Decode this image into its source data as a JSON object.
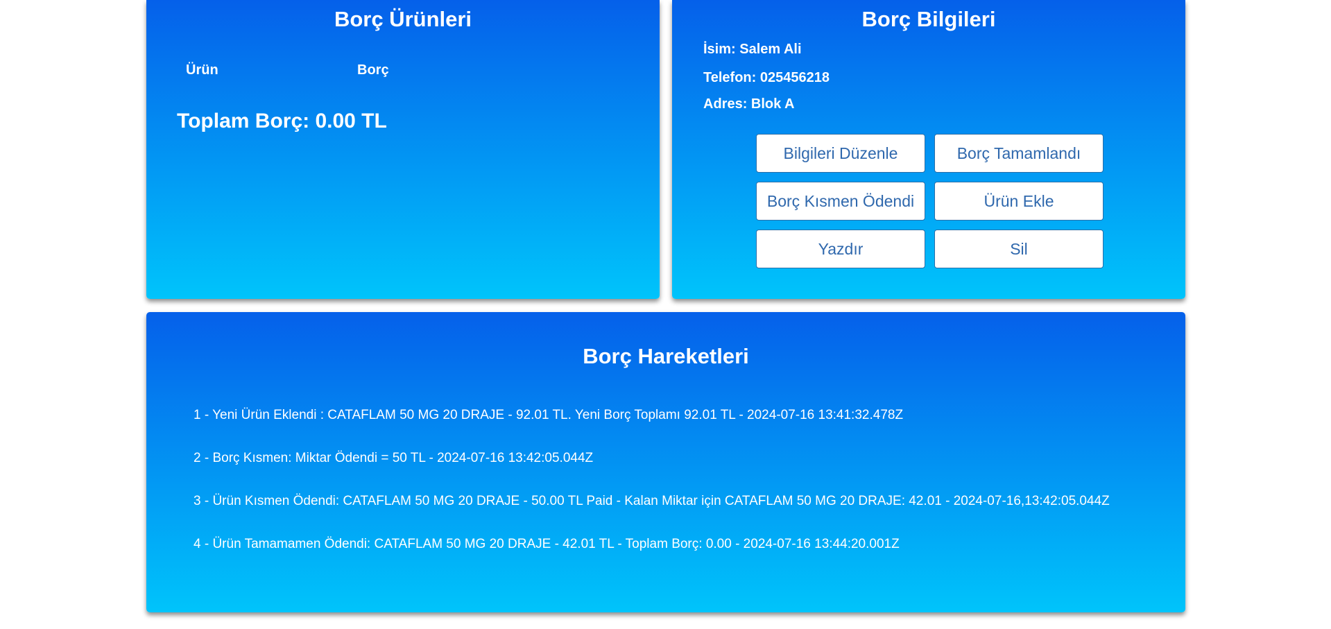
{
  "products_panel": {
    "title": "Borç Ürünleri",
    "col_product": "Ürün",
    "col_debt": "Borç",
    "total": "Toplam Borç: 0.00 TL"
  },
  "info_panel": {
    "title": "Borç Bilgileri",
    "name": "İsim: Salem Ali",
    "phone": "Telefon: 025456218",
    "address": "Adres: Blok A",
    "buttons": {
      "edit": "Bilgileri Düzenle",
      "completed": "Borç Tamamlandı",
      "partial": "Borç Kısmen Ödendi",
      "add_product": "Ürün Ekle",
      "print": "Yazdır",
      "delete": "Sil"
    }
  },
  "history_panel": {
    "title": "Borç Hareketleri",
    "items": [
      "1 - Yeni Ürün Eklendi : CATAFLAM 50 MG 20 DRAJE - 92.01 TL. Yeni Borç Toplamı 92.01 TL - 2024-07-16 13:41:32.478Z",
      "2 - Borç Kısmen: Miktar Ödendi = 50 TL - 2024-07-16 13:42:05.044Z",
      "3 - Ürün Kısmen Ödendi: CATAFLAM 50 MG 20 DRAJE - 50.00 TL Paid - Kalan Miktar için CATAFLAM 50 MG 20 DRAJE: 42.01 - 2024-07-16,13:42:05.044Z",
      "4 - Ürün Tamamamen Ödendi: CATAFLAM 50 MG 20 DRAJE - 42.01 TL - Toplam Borç: 0.00 - 2024-07-16 13:44:20.001Z"
    ]
  },
  "colors": {
    "gradient_top": "#0560ea",
    "gradient_bottom": "#00c4fb",
    "button_text": "#2f68ad",
    "button_border": "#2b6ea8"
  }
}
